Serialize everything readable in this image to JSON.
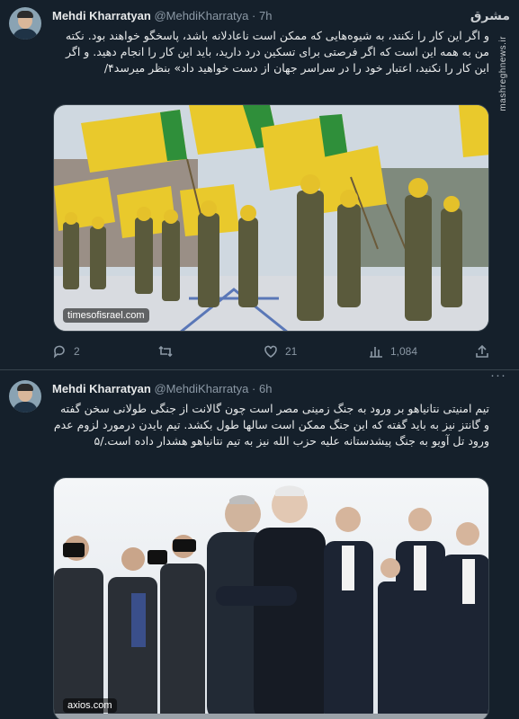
{
  "watermark": {
    "logo": "مشرق",
    "site": "mashreghnews.ir"
  },
  "tweets": [
    {
      "name": "Mehdi Kharratyan",
      "handle": "@MehdiKharratya",
      "time": "7h",
      "text": "و اگر این کار را نکنند، به شیوه‌هایی که ممکن است ناعادلانه باشد، پاسخگو خواهند بود. نکته من به همه این است که اگر فرصتی برای تسکین درد دارید، باید این کار را انجام دهید. و اگر این کار را نکنید، اعتبار خود را در سراسر جهان از دست خواهید داد» بنظر میرسد۴/",
      "media_source": "timesofisrael.com",
      "stats": {
        "replies": "2",
        "retweets": "",
        "likes": "21",
        "views": "1,084"
      }
    },
    {
      "name": "Mehdi Kharratyan",
      "handle": "@MehdiKharratya",
      "time": "6h",
      "text": "تیم امنیتی نتانیاهو بر ورود به جنگ زمینی مصر است چون گالانت از جنگی طولانی سخن گفته و گانتز نیز به باید گفته که این جنگ ممکن است سالها طول بکشد. تیم بایدن درمورد لزوم عدم ورود تل آویو به جنگ پیشدستانه علیه حزب الله نیز به تیم نتانیاهو هشدار داده است./۵",
      "media_source": "axios.com"
    }
  ],
  "colors": {
    "background": "#15202b",
    "text": "#e7e9ea",
    "muted": "#8b98a5",
    "divider": "#38444d",
    "flag_yellow": "#e9c92c",
    "flag_green": "#2f8f3a"
  }
}
